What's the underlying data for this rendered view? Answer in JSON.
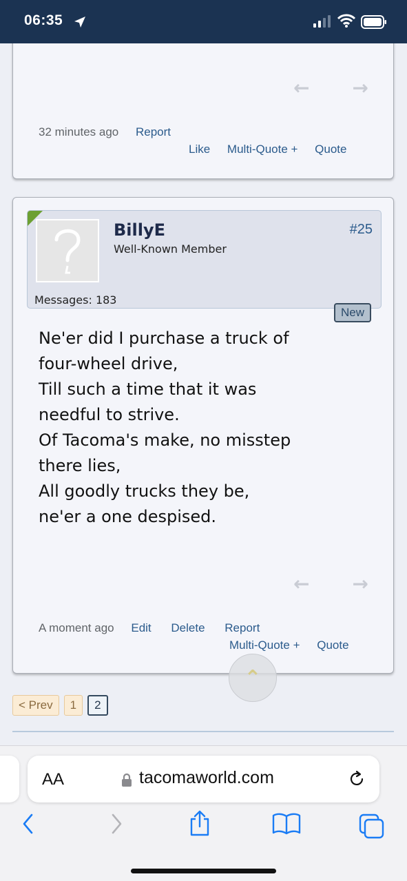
{
  "status_bar": {
    "time": "06:35"
  },
  "previous_post": {
    "timestamp": "32 minutes ago",
    "report": "Report",
    "like": "Like",
    "multi_quote": "Multi-Quote +",
    "quote": "Quote"
  },
  "post": {
    "username": "BillyE",
    "user_title": "Well-Known Member",
    "post_number": "#25",
    "messages": "Messages: 183",
    "new_badge": "New",
    "lines": [
      "Ne'er did I purchase a truck of",
      "four-wheel drive,",
      "Till such a time that it was",
      "needful to strive.",
      "Of Tacoma's make, no misstep",
      "there lies,",
      "All goodly trucks they be,",
      "ne'er a one despised."
    ],
    "timestamp": "A moment ago",
    "edit": "Edit",
    "delete": "Delete",
    "report": "Report",
    "multi_quote": "Multi-Quote +",
    "quote": "Quote"
  },
  "pagination": {
    "prev": "< Prev",
    "pages": [
      "1",
      "2"
    ],
    "current": "2"
  },
  "browser": {
    "aa": "AA",
    "domain": "tacomaworld.com"
  },
  "colors": {
    "status_bg": "#1b3352",
    "link": "#2b5b8c",
    "accent_green": "#6da033",
    "safari_blue": "#1a7cf5"
  },
  "icons": [
    "location-arrow-icon",
    "signal-icon",
    "wifi-icon",
    "battery-icon",
    "prev-arrow-icon",
    "next-arrow-icon",
    "avatar-placeholder-icon",
    "scroll-top-icon",
    "lock-icon",
    "reload-icon",
    "back-icon",
    "forward-icon",
    "share-icon",
    "bookmarks-icon",
    "tabs-icon"
  ]
}
